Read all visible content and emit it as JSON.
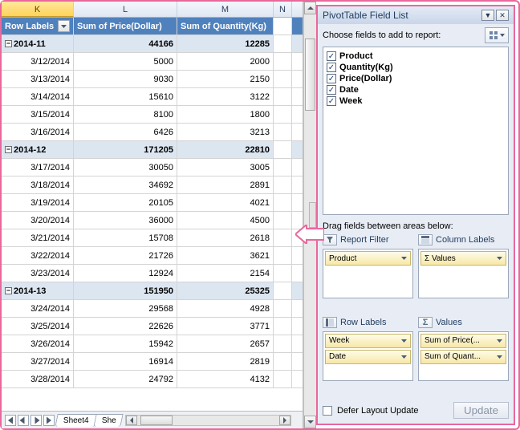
{
  "columns": {
    "K": "K",
    "L": "L",
    "M": "M",
    "N": "N"
  },
  "pivot_headers": {
    "row_labels": "Row Labels",
    "sum_price": "Sum of Price(Dollar)",
    "sum_qty": "Sum of Quantity(Kg)"
  },
  "rows": [
    {
      "type": "group",
      "label": "2014-11",
      "price": "44166",
      "qty": "12285"
    },
    {
      "type": "data",
      "label": "3/12/2014",
      "price": "5000",
      "qty": "2000"
    },
    {
      "type": "data",
      "label": "3/13/2014",
      "price": "9030",
      "qty": "2150"
    },
    {
      "type": "data",
      "label": "3/14/2014",
      "price": "15610",
      "qty": "3122"
    },
    {
      "type": "data",
      "label": "3/15/2014",
      "price": "8100",
      "qty": "1800"
    },
    {
      "type": "data",
      "label": "3/16/2014",
      "price": "6426",
      "qty": "3213"
    },
    {
      "type": "group",
      "label": "2014-12",
      "price": "171205",
      "qty": "22810"
    },
    {
      "type": "data",
      "label": "3/17/2014",
      "price": "30050",
      "qty": "3005"
    },
    {
      "type": "data",
      "label": "3/18/2014",
      "price": "34692",
      "qty": "2891"
    },
    {
      "type": "data",
      "label": "3/19/2014",
      "price": "20105",
      "qty": "4021"
    },
    {
      "type": "data",
      "label": "3/20/2014",
      "price": "36000",
      "qty": "4500"
    },
    {
      "type": "data",
      "label": "3/21/2014",
      "price": "15708",
      "qty": "2618"
    },
    {
      "type": "data",
      "label": "3/22/2014",
      "price": "21726",
      "qty": "3621"
    },
    {
      "type": "data",
      "label": "3/23/2014",
      "price": "12924",
      "qty": "2154"
    },
    {
      "type": "group",
      "label": "2014-13",
      "price": "151950",
      "qty": "25325"
    },
    {
      "type": "data",
      "label": "3/24/2014",
      "price": "29568",
      "qty": "4928"
    },
    {
      "type": "data",
      "label": "3/25/2014",
      "price": "22626",
      "qty": "3771"
    },
    {
      "type": "data",
      "label": "3/26/2014",
      "price": "15942",
      "qty": "2657"
    },
    {
      "type": "data",
      "label": "3/27/2014",
      "price": "16914",
      "qty": "2819"
    },
    {
      "type": "data",
      "label": "3/28/2014",
      "price": "24792",
      "qty": "4132"
    }
  ],
  "tabs": {
    "sheet4": "Sheet4",
    "sheet_trunc": "She"
  },
  "field_list": {
    "title": "PivotTable Field List",
    "choose_label": "Choose fields to add to report:",
    "fields": [
      {
        "label": "Product",
        "checked": true
      },
      {
        "label": "Quantity(Kg)",
        "checked": true
      },
      {
        "label": "Price(Dollar)",
        "checked": true
      },
      {
        "label": "Date",
        "checked": true
      },
      {
        "label": "Week",
        "checked": true
      }
    ],
    "drag_label": "Drag fields between areas below:",
    "areas": {
      "report_filter": {
        "title": "Report Filter",
        "chips": [
          "Product"
        ]
      },
      "column_labels": {
        "title": "Column Labels",
        "chips": [
          "Σ Values"
        ]
      },
      "row_labels": {
        "title": "Row Labels",
        "chips": [
          "Week",
          "Date"
        ]
      },
      "values": {
        "title": "Values",
        "chips": [
          "Sum of Price(...",
          "Sum of Quant..."
        ]
      }
    },
    "defer_label": "Defer Layout Update",
    "update_label": "Update"
  },
  "sigma": "Σ",
  "collapse_glyph": "−"
}
